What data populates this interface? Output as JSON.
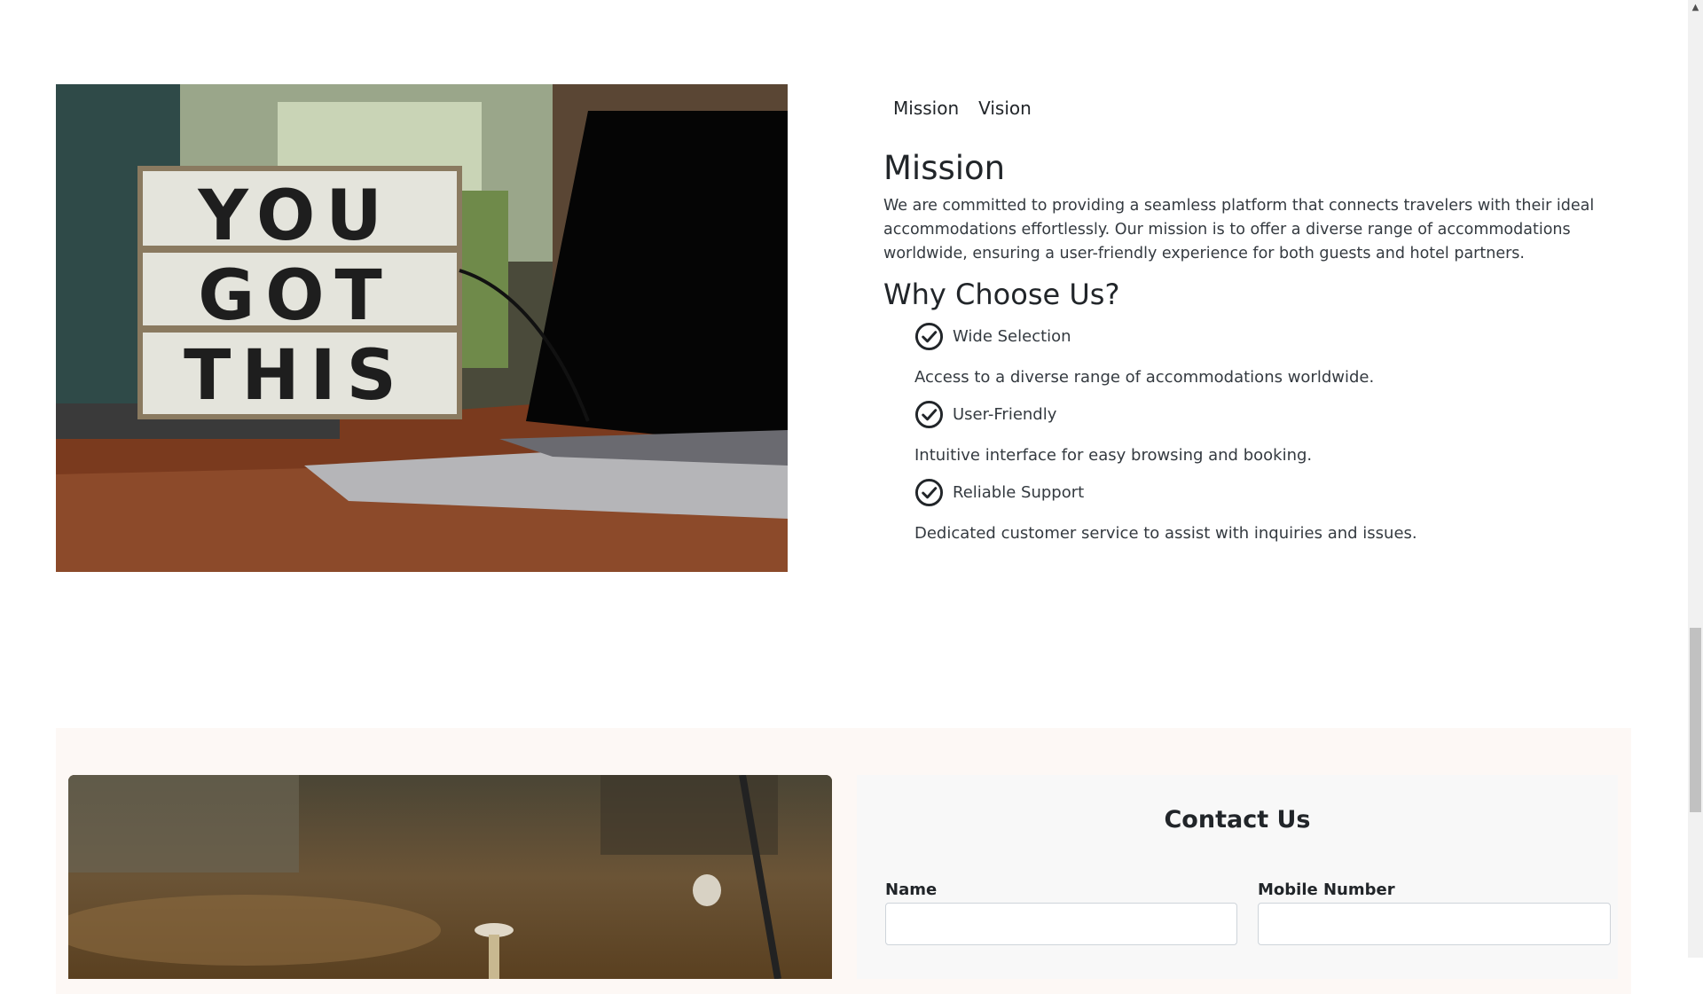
{
  "tabs": [
    "Mission",
    "Vision"
  ],
  "mission": {
    "title": "Mission",
    "text": "We are committed to providing a seamless platform that connects travelers with their ideal accommodations effortlessly. Our mission is to offer a diverse range of accommodations worldwide, ensuring a user-friendly experience for both guests and hotel partners."
  },
  "why": {
    "title": "Why Choose Us?",
    "features": [
      {
        "title": "Wide Selection",
        "desc": "Access to a diverse range of accommodations worldwide."
      },
      {
        "title": "User-Friendly",
        "desc": "Intuitive interface for easy browsing and booking."
      },
      {
        "title": "Reliable Support",
        "desc": "Dedicated customer service to assist with inquiries and issues."
      }
    ]
  },
  "hero_image": {
    "sign_lines": [
      "YOU",
      "GOT",
      "THIS"
    ]
  },
  "contact": {
    "title": "Contact Us",
    "name_label": "Name",
    "mobile_label": "Mobile Number",
    "name_value": "",
    "mobile_value": ""
  },
  "colors": {
    "band": "#fdf8f5",
    "card": "#f8f8f8",
    "text": "#212529"
  },
  "icons": {
    "feature": "check-circle-icon",
    "scroll": "scroll-up-arrow-icon"
  }
}
